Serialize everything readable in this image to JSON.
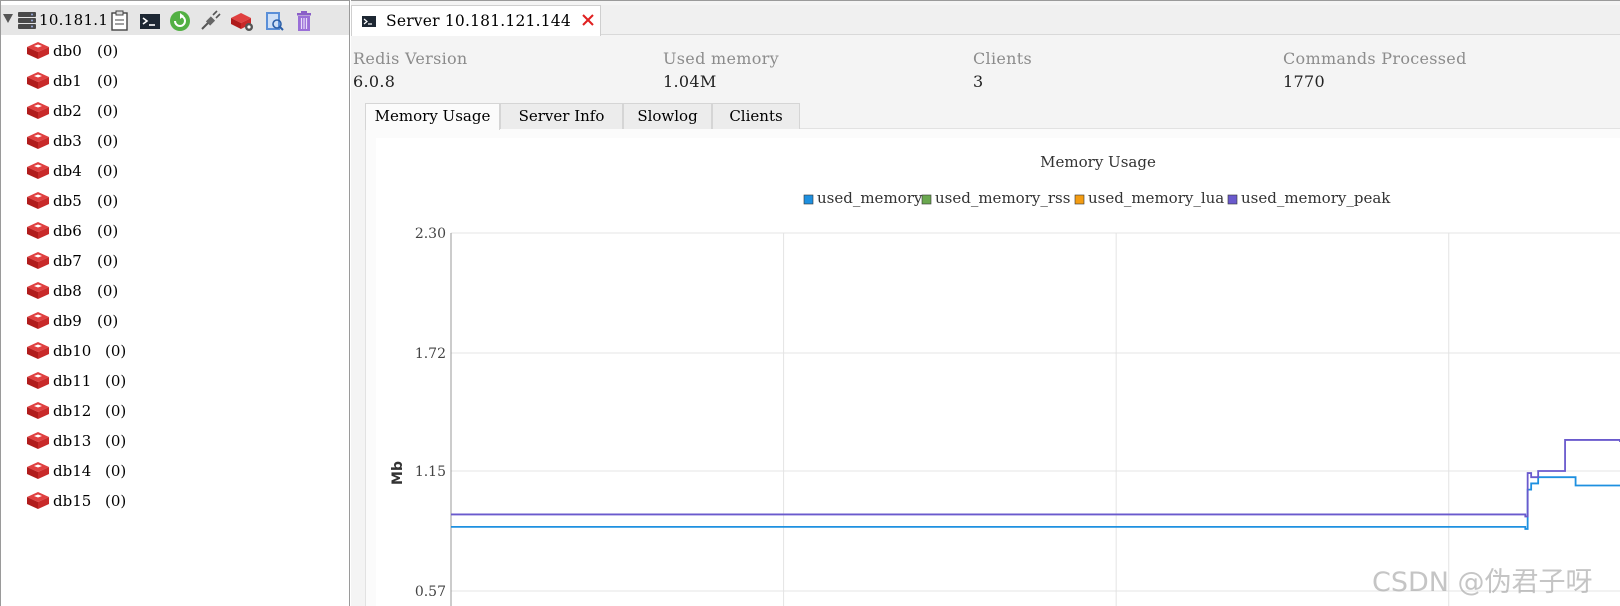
{
  "server": {
    "name": "10.181.1",
    "db_items": [
      {
        "name": "db0",
        "count": "(0)"
      },
      {
        "name": "db1",
        "count": "(0)"
      },
      {
        "name": "db2",
        "count": "(0)"
      },
      {
        "name": "db3",
        "count": "(0)"
      },
      {
        "name": "db4",
        "count": "(0)"
      },
      {
        "name": "db5",
        "count": "(0)"
      },
      {
        "name": "db6",
        "count": "(0)"
      },
      {
        "name": "db7",
        "count": "(0)"
      },
      {
        "name": "db8",
        "count": "(0)"
      },
      {
        "name": "db9",
        "count": "(0)"
      },
      {
        "name": "db10",
        "count": "(0)"
      },
      {
        "name": "db11",
        "count": "(0)"
      },
      {
        "name": "db12",
        "count": "(0)"
      },
      {
        "name": "db13",
        "count": "(0)"
      },
      {
        "name": "db14",
        "count": "(0)"
      },
      {
        "name": "db15",
        "count": "(0)"
      }
    ]
  },
  "toolbar": {
    "icons": [
      "console-icon",
      "terminal-icon",
      "reload-icon",
      "disconnect-icon",
      "server-settings-icon",
      "filter-icon",
      "delete-icon"
    ]
  },
  "tab": {
    "title": "Server 10.181.121.144"
  },
  "stats": {
    "redis_version_label": "Redis Version",
    "redis_version_value": "6.0.8",
    "used_memory_label": "Used memory",
    "used_memory_value": "1.04M",
    "clients_label": "Clients",
    "clients_value": "3",
    "commands_label": "Commands Processed",
    "commands_value": "1770"
  },
  "subtabs": [
    "Memory Usage",
    "Server Info",
    "Slowlog",
    "Clients"
  ],
  "colors": {
    "used_memory": "#1e90e0",
    "used_memory_rss": "#6aa84f",
    "used_memory_lua": "#f39c12",
    "used_memory_peak": "#6a5acd",
    "redis_red": "#cc2222",
    "close_red": "#e02020"
  },
  "chart_data": {
    "type": "line",
    "title": "Memory Usage",
    "ylabel": "Mb",
    "yticks": [
      "2.30",
      "1.72",
      "1.15",
      "0.57"
    ],
    "ylim": [
      0.57,
      2.3
    ],
    "legend": [
      "used_memory",
      "used_memory_rss",
      "used_memory_lua",
      "used_memory_peak"
    ],
    "series": [
      {
        "name": "used_memory",
        "x": [
          0,
          0.917,
          0.919,
          0.921,
          0.924,
          0.928,
          0.93,
          0.95,
          0.962,
          1.0
        ],
        "values": [
          0.88,
          0.88,
          0.87,
          1.06,
          1.09,
          1.09,
          1.12,
          1.12,
          1.08,
          1.08
        ]
      },
      {
        "name": "used_memory_peak",
        "x": [
          0,
          0.917,
          0.919,
          0.921,
          0.924,
          0.928,
          0.93,
          0.95,
          0.953,
          1.0
        ],
        "values": [
          0.94,
          0.94,
          0.93,
          1.14,
          1.12,
          1.12,
          1.15,
          1.15,
          1.3,
          1.29
        ]
      }
    ]
  },
  "watermark": "CSDN @伪君子呀"
}
